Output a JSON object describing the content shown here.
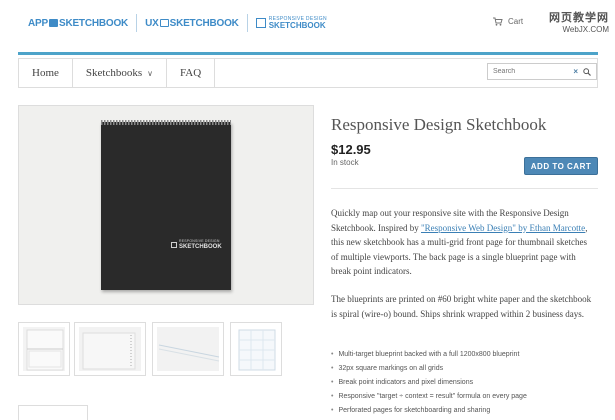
{
  "header": {
    "logo_app": "APP",
    "logo_app_b": "SKETCHBOOK",
    "logo_ux": "UX",
    "logo_ux_b": "SKETCHBOOK",
    "logo_rd_small": "RESPONSIVE DESIGN",
    "logo_rd_big": "SKETCHBOOK",
    "cart_label": "Cart",
    "watermark_line1": "网页教学网",
    "watermark_line2": "WebJX.COM"
  },
  "nav": {
    "items": [
      "Home",
      "Sketchbooks",
      "FAQ"
    ],
    "sketchbooks_chevron": "∨"
  },
  "search": {
    "placeholder": "Search",
    "clear": "×"
  },
  "product": {
    "title": "Responsive Design Sketchbook",
    "price": "$12.95",
    "stock": "In stock",
    "add_to_cart": "ADD TO CART",
    "pad_logo_small": "RESPONSIVE DESIGN",
    "pad_logo_big": "SKETCHBOOK",
    "para1_before": "Quickly map out your responsive site with the Responsive Design Sketchbook. Inspired by ",
    "para1_link": "\"Responsive Web Design\" by Ethan Marcotte",
    "para1_after": ", this new sketchbook has a multi-grid front page for thumbnail sketches of multiple viewports. The back page is a single blueprint page with break point indicators.",
    "para2": "The blueprints are printed on #60 bright white paper and the sketchbook is spiral (wire-o) bound. Ships shrink wrapped within 2 business days.",
    "bullets": [
      "Multi-target blueprint backed with a full 1200x800 blueprint",
      "32px square markings on all grids",
      "Break point indicators and pixel dimensions",
      "Responsive \"target ÷ context = result\" formula on every page",
      "Perforated pages for sketchboarding and sharing"
    ]
  },
  "colors": {
    "accent": "#3e8bc7",
    "bar": "#4da3c9",
    "button": "#4d88b6"
  }
}
